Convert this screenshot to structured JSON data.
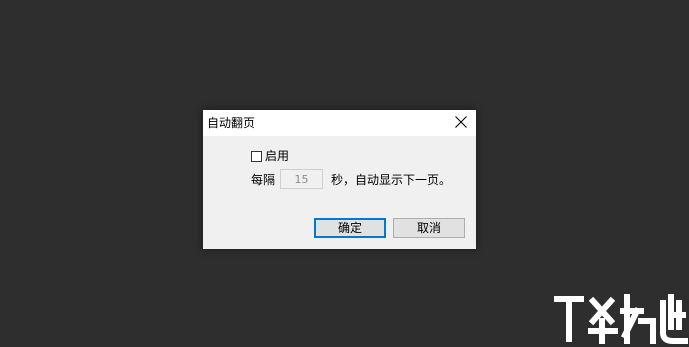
{
  "dialog": {
    "title": "自动翻页",
    "enable_label": "启用",
    "enable_checked": false,
    "interval_prefix": "每隔",
    "interval_value": "15",
    "interval_suffix": "秒，自动显示下一页。",
    "ok_label": "确定",
    "cancel_label": "取消"
  },
  "colors": {
    "background": "#2e2e2e",
    "dialog": "#f0f0f0",
    "accent": "#0078d7"
  },
  "watermark": {
    "icon": "site-logo-watermark"
  }
}
